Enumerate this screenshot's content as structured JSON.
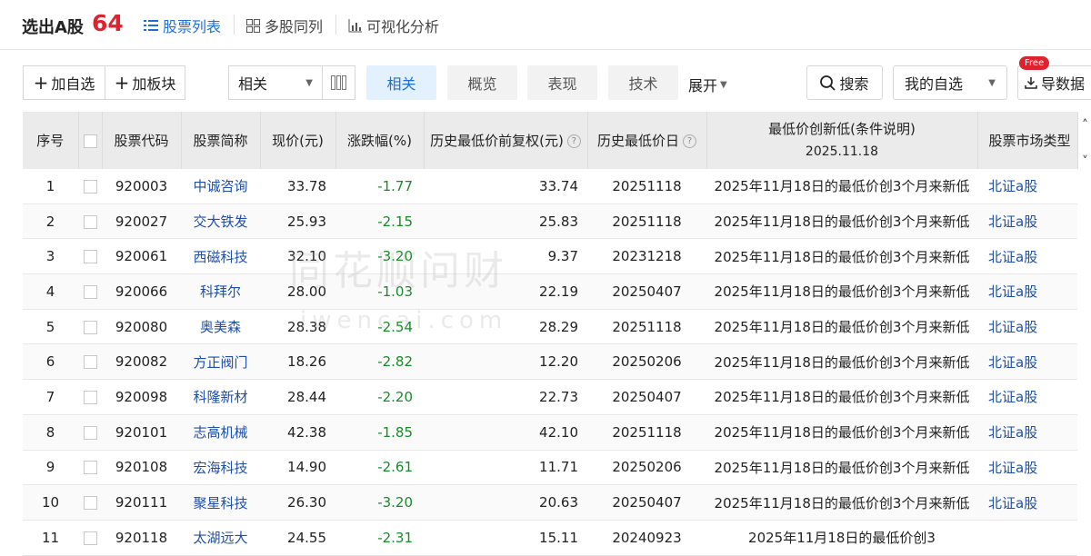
{
  "header": {
    "title": "选出A股",
    "count": "64",
    "tabs": [
      {
        "icon": "list-icon",
        "label": "股票列表",
        "active": true
      },
      {
        "icon": "grid-icon",
        "label": "多股同列",
        "active": false
      },
      {
        "icon": "bar-chart-icon",
        "label": "可视化分析",
        "active": false
      }
    ]
  },
  "toolbar": {
    "add_watchlist": "加自选",
    "add_sector": "加板块",
    "select_value": "相关",
    "view_tabs": [
      "相关",
      "概览",
      "表现",
      "技术"
    ],
    "expand": "展开",
    "search": "搜索",
    "my_watchlist": "我的自选",
    "free_badge": "Free",
    "export": "导数据"
  },
  "table": {
    "headers": {
      "seq": "序号",
      "code": "股票代码",
      "name": "股票简称",
      "price": "现价(元)",
      "change": "涨跌幅(%)",
      "hist_low_price": "历史最低价前复权(元)",
      "hist_low_date": "历史最低价日",
      "cond_title": "最低价创新低(条件说明)",
      "cond_date": "2025.11.18",
      "market": "股票市场类型"
    },
    "rows": [
      {
        "seq": "1",
        "code": "920003",
        "name": "中诚咨询",
        "price": "33.78",
        "change": "-1.77",
        "low": "33.74",
        "date": "20251118",
        "cond": "2025年11月18日的最低价创3个月来新低",
        "market": "北证a股"
      },
      {
        "seq": "2",
        "code": "920027",
        "name": "交大铁发",
        "price": "25.93",
        "change": "-2.15",
        "low": "25.83",
        "date": "20251118",
        "cond": "2025年11月18日的最低价创3个月来新低",
        "market": "北证a股"
      },
      {
        "seq": "3",
        "code": "920061",
        "name": "西磁科技",
        "price": "32.10",
        "change": "-3.20",
        "low": "9.37",
        "date": "20231218",
        "cond": "2025年11月18日的最低价创3个月来新低",
        "market": "北证a股"
      },
      {
        "seq": "4",
        "code": "920066",
        "name": "科拜尔",
        "price": "28.00",
        "change": "-1.03",
        "low": "22.19",
        "date": "20250407",
        "cond": "2025年11月18日的最低价创3个月来新低",
        "market": "北证a股"
      },
      {
        "seq": "5",
        "code": "920080",
        "name": "奥美森",
        "price": "28.38",
        "change": "-2.54",
        "low": "28.29",
        "date": "20251118",
        "cond": "2025年11月18日的最低价创3个月来新低",
        "market": "北证a股"
      },
      {
        "seq": "6",
        "code": "920082",
        "name": "方正阀门",
        "price": "18.26",
        "change": "-2.82",
        "low": "12.20",
        "date": "20250206",
        "cond": "2025年11月18日的最低价创3个月来新低",
        "market": "北证a股"
      },
      {
        "seq": "7",
        "code": "920098",
        "name": "科隆新材",
        "price": "28.44",
        "change": "-2.20",
        "low": "22.73",
        "date": "20250407",
        "cond": "2025年11月18日的最低价创3个月来新低",
        "market": "北证a股"
      },
      {
        "seq": "8",
        "code": "920101",
        "name": "志高机械",
        "price": "42.38",
        "change": "-1.85",
        "low": "42.10",
        "date": "20251118",
        "cond": "2025年11月18日的最低价创3个月来新低",
        "market": "北证a股"
      },
      {
        "seq": "9",
        "code": "920108",
        "name": "宏海科技",
        "price": "14.90",
        "change": "-2.61",
        "low": "11.71",
        "date": "20250206",
        "cond": "2025年11月18日的最低价创3个月来新低",
        "market": "北证a股"
      },
      {
        "seq": "10",
        "code": "920111",
        "name": "聚星科技",
        "price": "26.30",
        "change": "-3.20",
        "low": "20.63",
        "date": "20250407",
        "cond": "2025年11月18日的最低价创3个月来新低",
        "market": "北证a股"
      },
      {
        "seq": "11",
        "code": "920118",
        "name": "太湖远大",
        "price": "24.55",
        "change": "-2.31",
        "low": "15.11",
        "date": "20240923",
        "cond": "2025年11月18日的最低价创3",
        "market": ""
      }
    ]
  },
  "watermark": {
    "cn": "同花顺问财",
    "en": "iwencai.com"
  },
  "colors": {
    "accent": "#1f6fd8",
    "count_red": "#e0212e",
    "negative_green": "#1a8a2a",
    "link_blue": "#1f4fa8"
  }
}
